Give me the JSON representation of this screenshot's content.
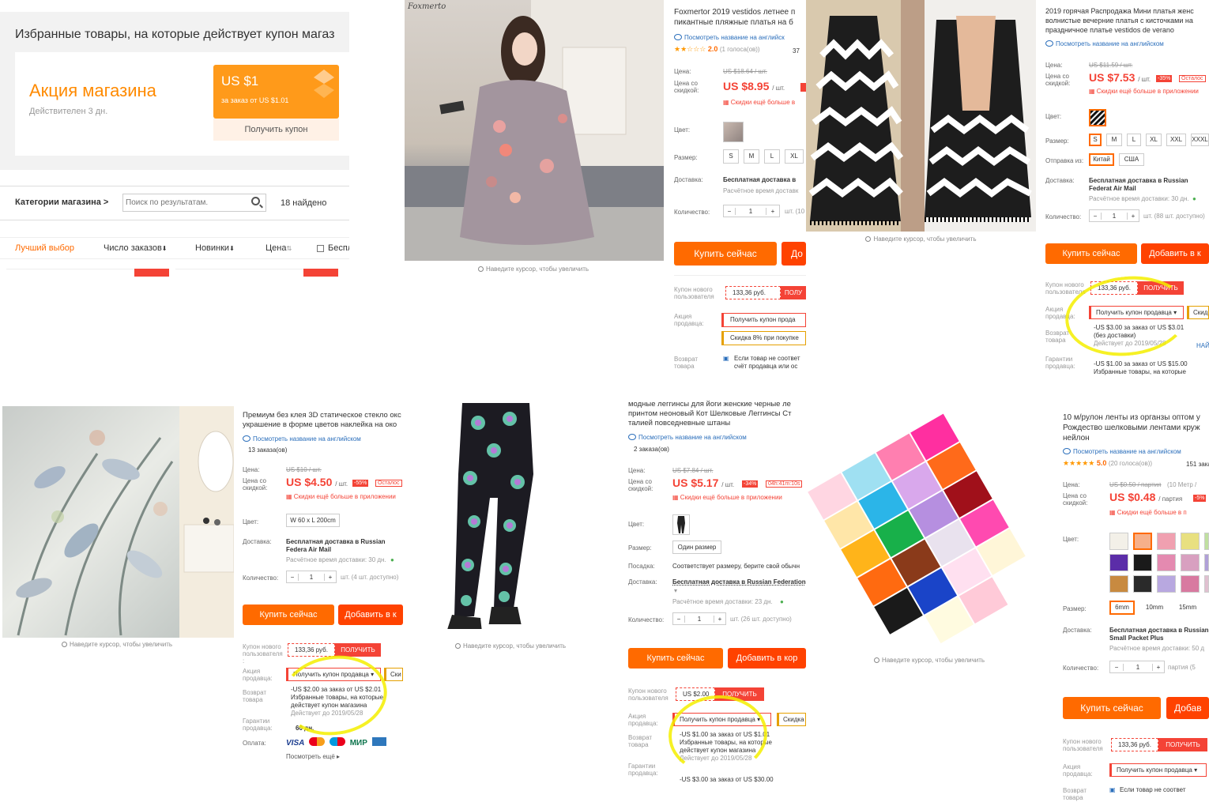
{
  "store": {
    "heading": "Избранные товары, на которые действует купон магаз",
    "promo_title": "Акция магазина",
    "promo_valid": "Действителен 3 дн.",
    "coupon_amount": "US $1",
    "coupon_condition": "за заказ от US $1.01",
    "coupon_button": "Получить купон",
    "categories": "Категории магазина >",
    "search_placeholder": "Поиск по результатам.",
    "found": "18 найдено",
    "sort_tabs": [
      "Лучший выбор",
      "Число заказов",
      "Новинки",
      "Цена"
    ],
    "free_shipping": "Беспл",
    "colors": {
      "accent": "#ff6a00",
      "sale_red": "#f44336"
    }
  },
  "p1": {
    "watermark": "Foxmerto",
    "title": "Foxmertor 2019 vestidos летнее п пикантные пляжные платья на б",
    "view_en": "Посмотреть название на английск",
    "rating": "2.0",
    "votes": "(1 голоса(ов))",
    "orders": "37",
    "price_label": "Цена:",
    "old_price": "US $18.64 / шт.",
    "disc_label": "Цена со скидкой:",
    "price": "US $8.95",
    "unit": "/ шт.",
    "app_discount": "Скидки ещё больше в",
    "color_label": "Цвет:",
    "size_label": "Размер:",
    "sizes": [
      "S",
      "M",
      "L",
      "XL"
    ],
    "delivery_label": "Доставка:",
    "delivery": "Бесплатная доставка в",
    "delivery_time": "Расчётное время доставк",
    "qty_label": "Количество:",
    "qty": "1",
    "qty_note": "шт. (10",
    "buy": "Купить сейчас",
    "cart": "До",
    "new_user_label": "Купон нового пользователя",
    "coupon_value": "133,36 руб.",
    "coupon_get": "ПОЛУ",
    "seller_label": "Акция продавца:",
    "seller_coupon": "Получить купон прода",
    "seller_discount": "Скидка 8% при покупке",
    "return_label": "Возврат товара",
    "return_text": "Если товар не соответ счёт продавца или ос",
    "zoom": "Наведите курсор, чтобы увеличить"
  },
  "p2": {
    "title": "2019 горячая Распродажа Мини платья женс волнистые вечерние платья с кисточками на праздничное платье vestidos de verano",
    "view_en": "Посмотреть название на английском",
    "price_label": "Цена:",
    "old_price": "US $11.59 / шт.",
    "disc_label": "Цена со скидкой:",
    "price": "US $7.53",
    "unit": "/ шт.",
    "discount": "-35%",
    "left": "Осталос",
    "app_discount": "Скидки ещё больше в приложении",
    "color_label": "Цвет:",
    "size_label": "Размер:",
    "sizes": [
      "S",
      "M",
      "L",
      "XL",
      "XXL",
      "XXXL"
    ],
    "ship_from_label": "Отправка из:",
    "ship_from": [
      "Китай",
      "США"
    ],
    "delivery_label": "Доставка:",
    "delivery": "Бесплатная доставка в Russian Federat Air Mail",
    "delivery_time": "Расчётное время доставки: 30 дн.",
    "qty_label": "Количество:",
    "qty": "1",
    "qty_note": "шт. (88 шт. доступно)",
    "buy": "Купить сейчас",
    "cart": "Добавить в к",
    "new_user_label": "Купон нового пользователя",
    "coupon_value": "133,36 руб.",
    "coupon_get": "ПОЛУЧИТЬ",
    "seller_label": "Акция продавца:",
    "seller_coupon": "Получить купон продавца",
    "seller_other": "Скид",
    "pop_line1": "-US $3.00 за заказ от US $3.01",
    "pop_line2": "(без доставки)",
    "pop_valid": "Действует до 2019/05/28",
    "pop_more": "НАЙ",
    "return_label": "Возврат товара",
    "guarantee_label": "Гарантии продавца:",
    "pop2_line1": "-US $1.00 за заказ от US $15.00",
    "pop2_line2": "Избранные товары, на которые",
    "zoom": "Наведите курсор, чтобы увеличить"
  },
  "p3": {
    "title": "Премиум без клея 3D статическое стекло окс украшение в форме цветов наклейка на око",
    "view_en": "Посмотреть название на английском",
    "orders": "13 заказа(ов)",
    "price_label": "Цена:",
    "old_price": "US $10 / шт.",
    "disc_label": "Цена со скидкой:",
    "price": "US $4.50",
    "unit": "/ шт.",
    "discount": "-55%",
    "left": "Осталос",
    "app_discount": "Скидки ещё больше в приложении",
    "color_label": "Цвет:",
    "color_value": "W 60 x L 200cm",
    "delivery_label": "Доставка:",
    "delivery": "Бесплатная доставка в Russian Federa Air Mail",
    "delivery_time": "Расчётное время доставки: 30 дн.",
    "qty_label": "Количество:",
    "qty": "1",
    "qty_note": "шт. (4 шт. доступно)",
    "buy": "Купить сейчас",
    "cart": "Добавить в к",
    "new_user_label": "Купон нового пользователя :",
    "coupon_value": "133,36 руб.",
    "coupon_get": "ПОЛУЧИТЬ",
    "seller_label": "Акция продавца:",
    "seller_coupon": "Получить купон продавца",
    "seller_other": "Ски",
    "pop_line1": "-US $2.00 за заказ от US $2.01",
    "pop_line2": "Избранные товары, на которые",
    "pop_line3": "действует купон магазина",
    "pop_valid": "Действует до 2019/05/28",
    "return_label": "Возврат товара",
    "guarantee_label": "Гарантии продавца:",
    "guarantee_days": "60 дн.",
    "pay_label": "Оплата:",
    "pay_methods": [
      "VISA",
      "MC",
      "Maestro",
      "МИР",
      "AMEX"
    ],
    "more": "Посмотреть ещё",
    "zoom": "Наведите курсор, чтобы увеличить"
  },
  "p4": {
    "title": "модные леггинсы для йоги женские черные ле принтом неоновый Кот Шелковые Леггинсы Ст талией повседневные штаны",
    "view_en": "Посмотреть название на английском",
    "orders": "2 заказа(ов)",
    "price_label": "Цена:",
    "old_price": "US $7.84 / шт.",
    "disc_label": "Цена со скидкой:",
    "price": "US $5.17",
    "unit": "/ шт.",
    "discount": "-34%",
    "timer": "04h:41m:10s",
    "app_discount": "Скидки ещё больше в приложении",
    "color_label": "Цвет:",
    "size_label": "Размер:",
    "size_value": "Один размер",
    "fit_label": "Посадка:",
    "fit_value": "Соответствует размеру, берите свой обычн",
    "delivery_label": "Доставка:",
    "delivery": "Бесплатная доставка в Russian Federation",
    "delivery_time": "Расчётное время доставки: 23 дн.",
    "qty_label": "Количество:",
    "qty": "1",
    "qty_note": "шт. (26 шт. доступно)",
    "buy": "Купить сейчас",
    "cart": "Добавить в кор",
    "new_user_label": "Купон нового пользователя",
    "coupon_value": "US $2.00",
    "coupon_get": "ПОЛУЧИТЬ",
    "seller_label": "Акция продавца:",
    "seller_coupon": "Получить купон продавца",
    "seller_other": "Скидка",
    "pop_line1": "-US $1.00 за заказ от US $1.01",
    "pop_line2": "Избранные товары, на которые",
    "pop_line3": "действует купон магазина",
    "pop_valid": "Действует до 2019/05/28",
    "return_label": "Возврат товара",
    "guarantee_label": "Гарантии продавца:",
    "pop2_line1": "-US $3.00 за заказ от US $30.00",
    "zoom": "Наведите курсор, чтобы увеличить"
  },
  "p5": {
    "title": "10 м/рулон ленты из органзы оптом у Рождество шелковыми лентами круж нейлон",
    "view_en": "Посмотреть название на английском",
    "rating": "5.0",
    "votes": "(20 голоса(ов))",
    "orders": "151 заказ",
    "price_label": "Цена:",
    "old_price": "US $0.50 / партия",
    "old_note": "(10 Метр /",
    "disc_label": "Цена со скидкой:",
    "price": "US $0.48",
    "unit": "/ партия",
    "discount": "-5%",
    "app_discount": "Скидки ещё больше в п",
    "color_label": "Цвет:",
    "size_label": "Размер:",
    "sizes": [
      "6mm",
      "10mm",
      "15mm"
    ],
    "delivery_label": "Доставка:",
    "delivery": "Бесплатная доставка в Russian Small Packet Plus",
    "delivery_time": "Расчётное время доставки: 50 д",
    "qty_label": "Количество:",
    "qty": "1",
    "qty_note": "партия (5",
    "buy": "Купить сейчас",
    "cart": "Добав",
    "new_user_label": "Купон нового пользователя",
    "coupon_value": "133,36 руб.",
    "coupon_get": "ПОЛУЧИТЬ",
    "seller_label": "Акция продавца:",
    "seller_coupon": "Получить купон продавца",
    "return_label": "Возврат товара",
    "return_text": "Если товар не соответ",
    "zoom": "Наведите курсор, чтобы увеличить"
  }
}
